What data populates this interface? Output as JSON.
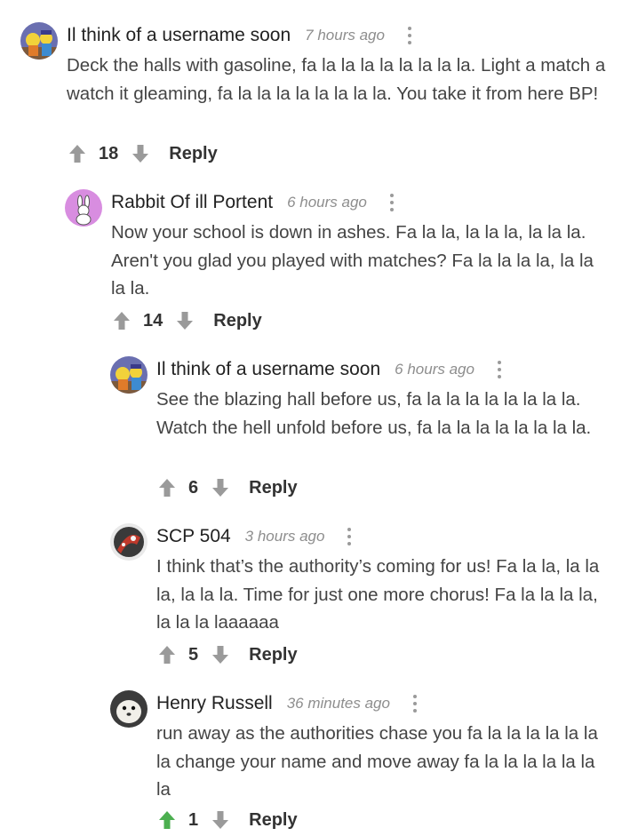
{
  "colors": {
    "upvote_default": "#9a9a9a",
    "upvote_active": "#4caf50",
    "downvote": "#9a9a9a",
    "username": "#222222",
    "timestamp": "#8e8e8e",
    "body_text": "#444444"
  },
  "comments": [
    {
      "username": "Il think of a username soon",
      "time": "7 hours ago",
      "text": "Deck the halls with gasoline, fa la la la la la la la la. Light a match a watch it gleaming, fa la la la la la la la la. You take it from here BP!",
      "votes": "18",
      "reply_label": "Reply",
      "avatar_icon": "simpsons-avatar-icon",
      "upvoted": false
    },
    {
      "username": "Rabbit Of ill Portent",
      "time": "6 hours ago",
      "text": "Now your school is down in ashes. Fa la la, la la la, la la la. Aren't you glad you played with matches? Fa la la la la, la la la la.",
      "votes": "14",
      "reply_label": "Reply",
      "avatar_icon": "rabbit-avatar-icon",
      "upvoted": false
    },
    {
      "username": "Il think of a username soon",
      "time": "6 hours ago",
      "text": "See the blazing hall before us, fa la la la la la la la la. Watch the hell unfold before us, fa la la la la la la la la.",
      "votes": "6",
      "reply_label": "Reply",
      "avatar_icon": "simpsons-avatar-icon",
      "upvoted": false
    },
    {
      "username": "SCP 504",
      "time": "3 hours ago",
      "text": "I think that’s the authority’s coming for us! Fa la la, la la la, la la la. Time for just one more chorus! Fa la la la la, la la la laaaaaa",
      "votes": "5",
      "reply_label": "Reply",
      "avatar_icon": "scp-avatar-icon",
      "upvoted": false
    },
    {
      "username": "Henry Russell",
      "time": "36 minutes ago",
      "text": "run away as the authorities chase you fa la la la la la la la change your name and move away fa la la la la la la la",
      "votes": "1",
      "reply_label": "Reply",
      "avatar_icon": "seal-avatar-icon",
      "upvoted": true
    }
  ]
}
